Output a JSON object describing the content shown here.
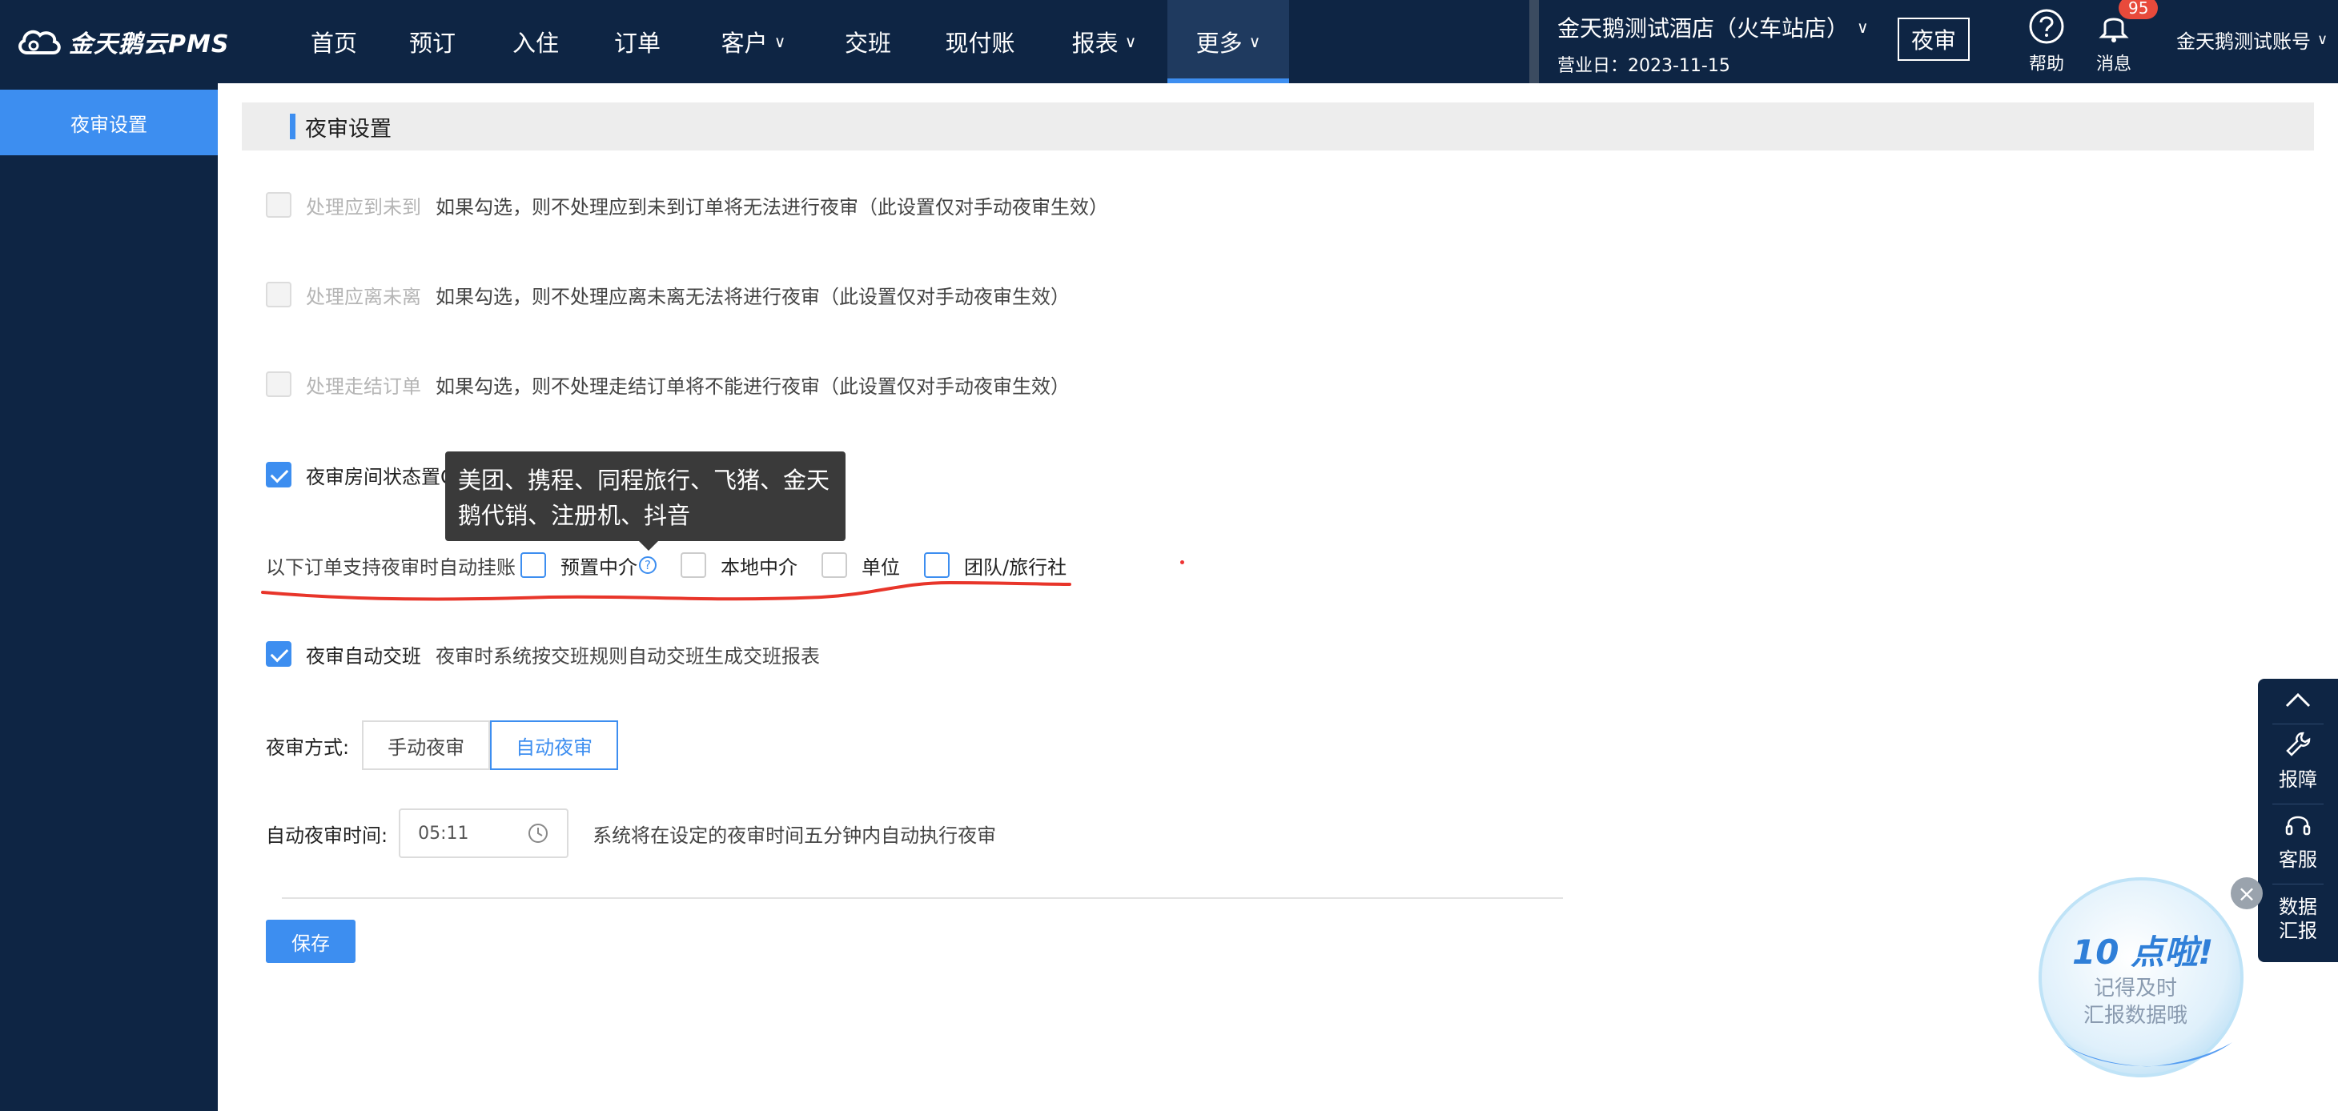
{
  "app": {
    "name": "金天鹅云PMS"
  },
  "nav": {
    "items": [
      {
        "label": "首页",
        "dropdown": false
      },
      {
        "label": "预订",
        "dropdown": false
      },
      {
        "label": "入住",
        "dropdown": false
      },
      {
        "label": "订单",
        "dropdown": false
      },
      {
        "label": "客户",
        "dropdown": true
      },
      {
        "label": "交班",
        "dropdown": false
      },
      {
        "label": "现付账",
        "dropdown": false
      },
      {
        "label": "报表",
        "dropdown": true
      },
      {
        "label": "更多",
        "dropdown": true,
        "active": true
      }
    ]
  },
  "header": {
    "hotel_name": "金天鹅测试酒店（火车站店）",
    "business_date": "营业日：2023-11-15",
    "audit_button": "夜审",
    "help_label": "帮助",
    "message_label": "消息",
    "message_count": "95",
    "account": "金天鹅测试账号"
  },
  "sidebar": {
    "items": [
      {
        "label": "夜审设置",
        "active": true
      }
    ]
  },
  "main": {
    "section_title": "夜审设置",
    "settings": [
      {
        "label": "处理应到未到",
        "desc": "如果勾选，则不处理应到未到订单将无法进行夜审（此设置仅对手动夜审生效）",
        "checked": false,
        "disabled": true
      },
      {
        "label": "处理应离未离",
        "desc": "如果勾选，则不处理应离未离无法将进行夜审（此设置仅对手动夜审生效）",
        "checked": false,
        "disabled": true
      },
      {
        "label": "处理走结订单",
        "desc": "如果勾选，则不处理走结订单将不能进行夜审（此设置仅对手动夜审生效）",
        "checked": false,
        "disabled": true
      },
      {
        "label": "夜审房间状态置OD",
        "desc": "",
        "checked": true,
        "disabled": false
      }
    ],
    "auto_settle": {
      "prefix": "以下订单支持夜审时自动挂账",
      "options": [
        {
          "label": "预置中介",
          "has_help": true,
          "style": "blue"
        },
        {
          "label": "本地中介",
          "style": "plain"
        },
        {
          "label": "单位",
          "style": "plain"
        },
        {
          "label": "团队/旅行社",
          "style": "blue"
        }
      ]
    },
    "tooltip": "美团、携程、同程旅行、飞猪、金天鹅代销、注册机、抖音",
    "auto_shift": {
      "label": "夜审自动交班",
      "desc": "夜审时系统按交班规则自动交班生成交班报表",
      "checked": true
    },
    "mode": {
      "label": "夜审方式:",
      "options": [
        "手动夜审",
        "自动夜审"
      ],
      "selected": "自动夜审"
    },
    "auto_time": {
      "label": "自动夜审时间:",
      "value": "05:11",
      "note": "系统将在设定的夜审时间五分钟内自动执行夜审"
    },
    "save_label": "保存"
  },
  "float_bar": {
    "items": [
      "报障",
      "客服",
      "数据汇报"
    ]
  },
  "promo": {
    "title": "10 点啦!",
    "line1": "记得及时",
    "line2": "汇报数据哦"
  },
  "colors": {
    "navy": "#0e2544",
    "accent": "#3d8ef0",
    "annotation_red": "#e8352a"
  }
}
